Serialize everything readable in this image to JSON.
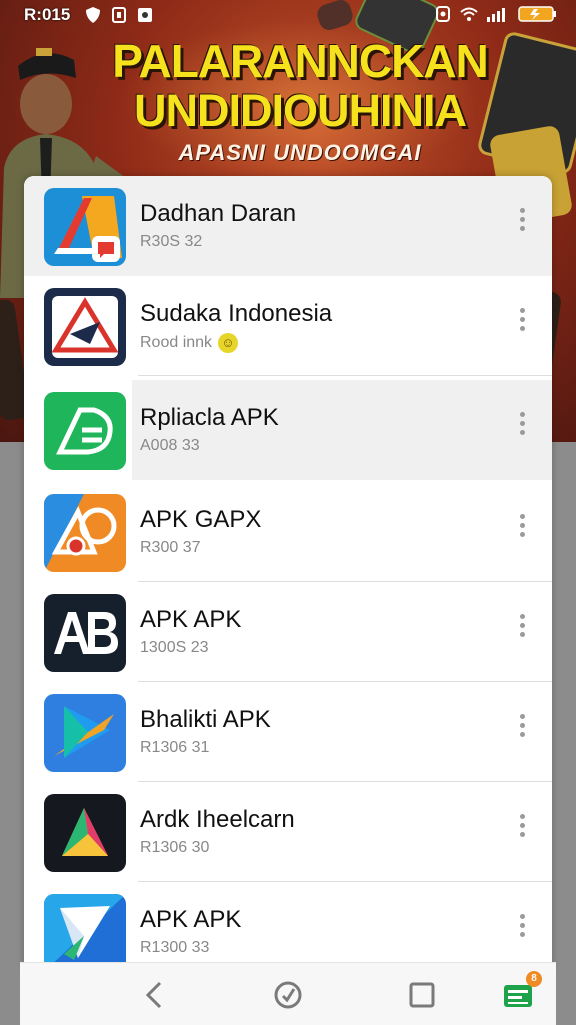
{
  "status_bar": {
    "time": "R:015"
  },
  "banner": {
    "headline_line1": "PALARANNCKAN",
    "headline_line2": "UNDIDIOUHINIA",
    "subheadline": "APASNI UNDOOMGAI",
    "colors": {
      "headline": "#f6e21c",
      "background": "#8e2a17"
    }
  },
  "apps": [
    {
      "title": "Dadhan Daran",
      "subtitle": "R30S 32",
      "icon": "red-blue-triangle-app-icon"
    },
    {
      "title": "Sudaka Indonesia",
      "subtitle": "Rood innk",
      "icon": "red-triangle-map-icon",
      "badge": "smiley-badge-icon"
    },
    {
      "title": "Rpliacla APK",
      "subtitle": "A008 33",
      "icon": "green-a-app-icon"
    },
    {
      "title": "APK GAPX",
      "subtitle": "R300 37",
      "icon": "orange-blue-pin-icon"
    },
    {
      "title": "APK APK",
      "subtitle": "1300S 23",
      "icon": "ab-letters-icon"
    },
    {
      "title": "Bhalikti APK",
      "subtitle": "R1306 31",
      "icon": "blue-play-arrow-icon"
    },
    {
      "title": "Ardk Iheelcarn",
      "subtitle": "R1306 30",
      "icon": "dark-play-triangle-icon"
    },
    {
      "title": "APK APK",
      "subtitle": "R1300 33",
      "icon": "blue-paper-plane-icon"
    }
  ],
  "navbar": {
    "back": "back-icon",
    "home": "home-icon",
    "recents": "recents-icon",
    "store_badge": "8"
  }
}
